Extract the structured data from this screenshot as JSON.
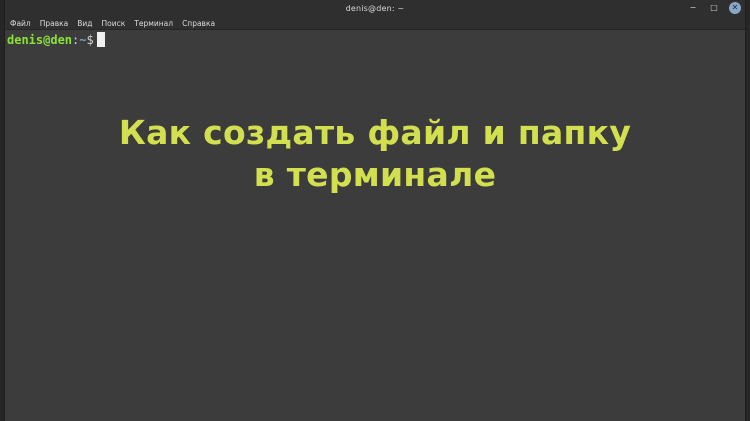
{
  "window": {
    "title": "denis@den: ~",
    "controls": {
      "minimize": "−",
      "maximize": "□",
      "close": "✕"
    }
  },
  "menubar": {
    "items": [
      "Файл",
      "Правка",
      "Вид",
      "Поиск",
      "Терминал",
      "Справка"
    ]
  },
  "terminal": {
    "prompt_user_host": "denis@den",
    "prompt_separator": ":",
    "prompt_path": "~",
    "prompt_symbol": "$"
  },
  "overlay": {
    "line1": "Как создать файл и папку",
    "line2": "в терминале"
  },
  "colors": {
    "terminal_bg": "#3c3c3c",
    "titlebar_bg": "#2f2f2f",
    "prompt_user": "#8ae234",
    "prompt_path": "#729fcf",
    "headline": "#d2e04f",
    "close_button": "#8aa6c8"
  }
}
